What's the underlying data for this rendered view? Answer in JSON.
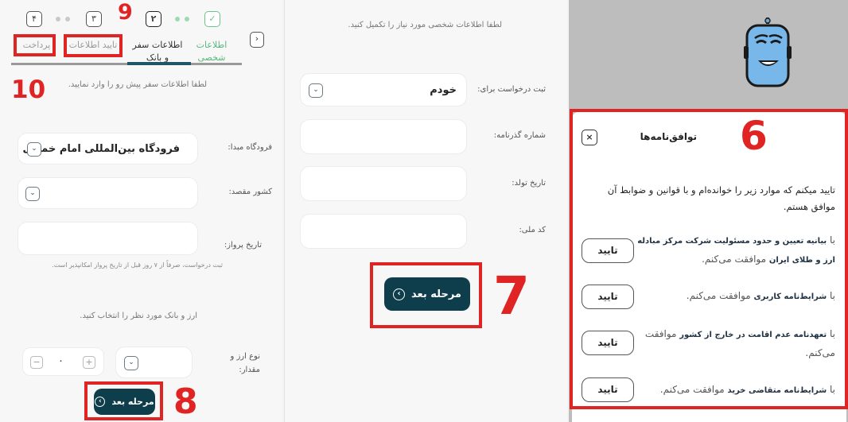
{
  "annotations": [
    "9",
    "10",
    "8",
    "7",
    "6"
  ],
  "travel": {
    "steps": [
      "۴",
      "۳",
      "۲",
      "✓"
    ],
    "step_labels": {
      "payment": "پرداخت",
      "confirm": "تایید اطلاعات",
      "travel_bank_line1": "اطلاعات سفر",
      "travel_bank_line2": "و بانک",
      "personal_line1": "اطلاعات",
      "personal_line2": "شخصی"
    },
    "back_icon": "›",
    "intro": "لطفا اطلاعات سفر پیش رو را وارد نمایید.",
    "origin_airport": {
      "label": "فرودگاه مبدا:",
      "value": "فرودگاه بین‌المللی امام خمینی"
    },
    "destination_country": {
      "label": "کشور مقصد:",
      "value": ""
    },
    "flight_date": {
      "label": "تاریخ پرواز:",
      "value": "",
      "note": "ثبت درخواست، صرفاً از ۷ روز قبل از تاریخ پرواز امکانپذیر است."
    },
    "currency_intro": "ارز و بانک مورد نظر را انتخاب کنید.",
    "currency": {
      "label_line1": "نوع ارز و",
      "label_line2": "مقدار:",
      "amount": "۰",
      "minus": "−",
      "plus": "+"
    },
    "next_button": "مرحله بعد",
    "next_icon": "‹",
    "chevron": "⌄"
  },
  "personal": {
    "intro": "لطفا اطلاعات شخصی مورد نیاز را تکمیل کنید.",
    "request_for": {
      "label": "ثبت درخواست برای:",
      "value": "خودم"
    },
    "passport": {
      "label": "شماره گذرنامه:",
      "value": ""
    },
    "birth_date": {
      "label": "تاریخ تولد:",
      "value": ""
    },
    "national_code": {
      "label": "کد ملی:",
      "value": ""
    },
    "next_button": "مرحله بعد",
    "next_icon": "‹",
    "chevron": "⌄"
  },
  "agreements": {
    "title": "توافق‌نامه‌ها",
    "close_icon": "×",
    "intro": "تایید میکنم که موارد زیر را خوانده‌ام و با قوانین و ضوابط آن موافق هستم.",
    "confirm_label": "تایید",
    "items": [
      {
        "prefix": "با ",
        "bold": "بیانیه تعیین و حدود مسئولیت شرکت مرکز مبادله ارز و طلای ایران",
        "suffix": " موافقت می‌کنم."
      },
      {
        "prefix": "با ",
        "bold": "شرایط‌نامه کاربری",
        "suffix": " موافقت می‌کنم."
      },
      {
        "prefix": "با ",
        "bold": "تعهدنامه عدم اقامت در خارج از کشور",
        "suffix": " موافقت می‌کنم."
      },
      {
        "prefix": "با ",
        "bold": "شرایط‌نامه متقاضی خرید",
        "suffix": " موافقت می‌کنم."
      }
    ]
  },
  "colors": {
    "primary": "#0e3e4c",
    "annotation_red": "#e02424",
    "success_green": "#5bb67d"
  }
}
